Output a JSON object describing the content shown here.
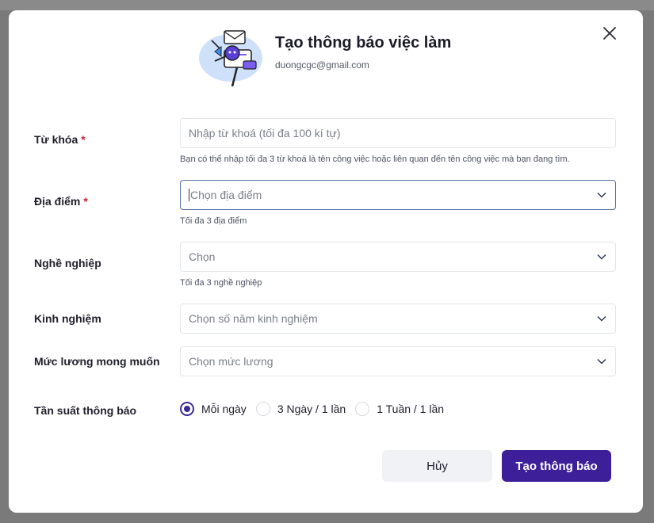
{
  "dialog": {
    "title": "Tạo thông báo việc làm",
    "email": "duongcgc@gmail.com"
  },
  "form": {
    "keyword": {
      "label": "Từ khóa",
      "required_mark": "*",
      "placeholder": "Nhập từ khoá (tối đa 100 kí tự)",
      "hint": "Bạn có thể nhập tối đa 3 từ khoá là tên công việc hoặc liên quan đến tên công việc mà bạn đang tìm."
    },
    "location": {
      "label": "Địa điểm",
      "required_mark": "*",
      "placeholder": "Chọn địa điểm",
      "hint": "Tối đa 3 địa điểm"
    },
    "occupation": {
      "label": "Nghề nghiệp",
      "placeholder": "Chọn",
      "hint": "Tối đa 3 nghề nghiệp"
    },
    "experience": {
      "label": "Kinh nghiệm",
      "placeholder": "Chọn số năm kinh nghiệm"
    },
    "salary": {
      "label": "Mức lương mong muốn",
      "placeholder": "Chọn mức lương"
    },
    "frequency": {
      "label": "Tần suất thông báo",
      "options": [
        "Mỗi ngày",
        "3 Ngày / 1 lần",
        "1 Tuần / 1 lần"
      ],
      "selected": "Mỗi ngày"
    }
  },
  "buttons": {
    "cancel": "Hủy",
    "submit": "Tạo thông báo"
  },
  "icons": {
    "close": "close-icon",
    "chevron": "chevron-down-icon",
    "illustration": "mailbox-illustration-icon"
  },
  "colors": {
    "primary": "#3e1f9a",
    "required": "#d1202f",
    "active_border": "#5470a8"
  }
}
